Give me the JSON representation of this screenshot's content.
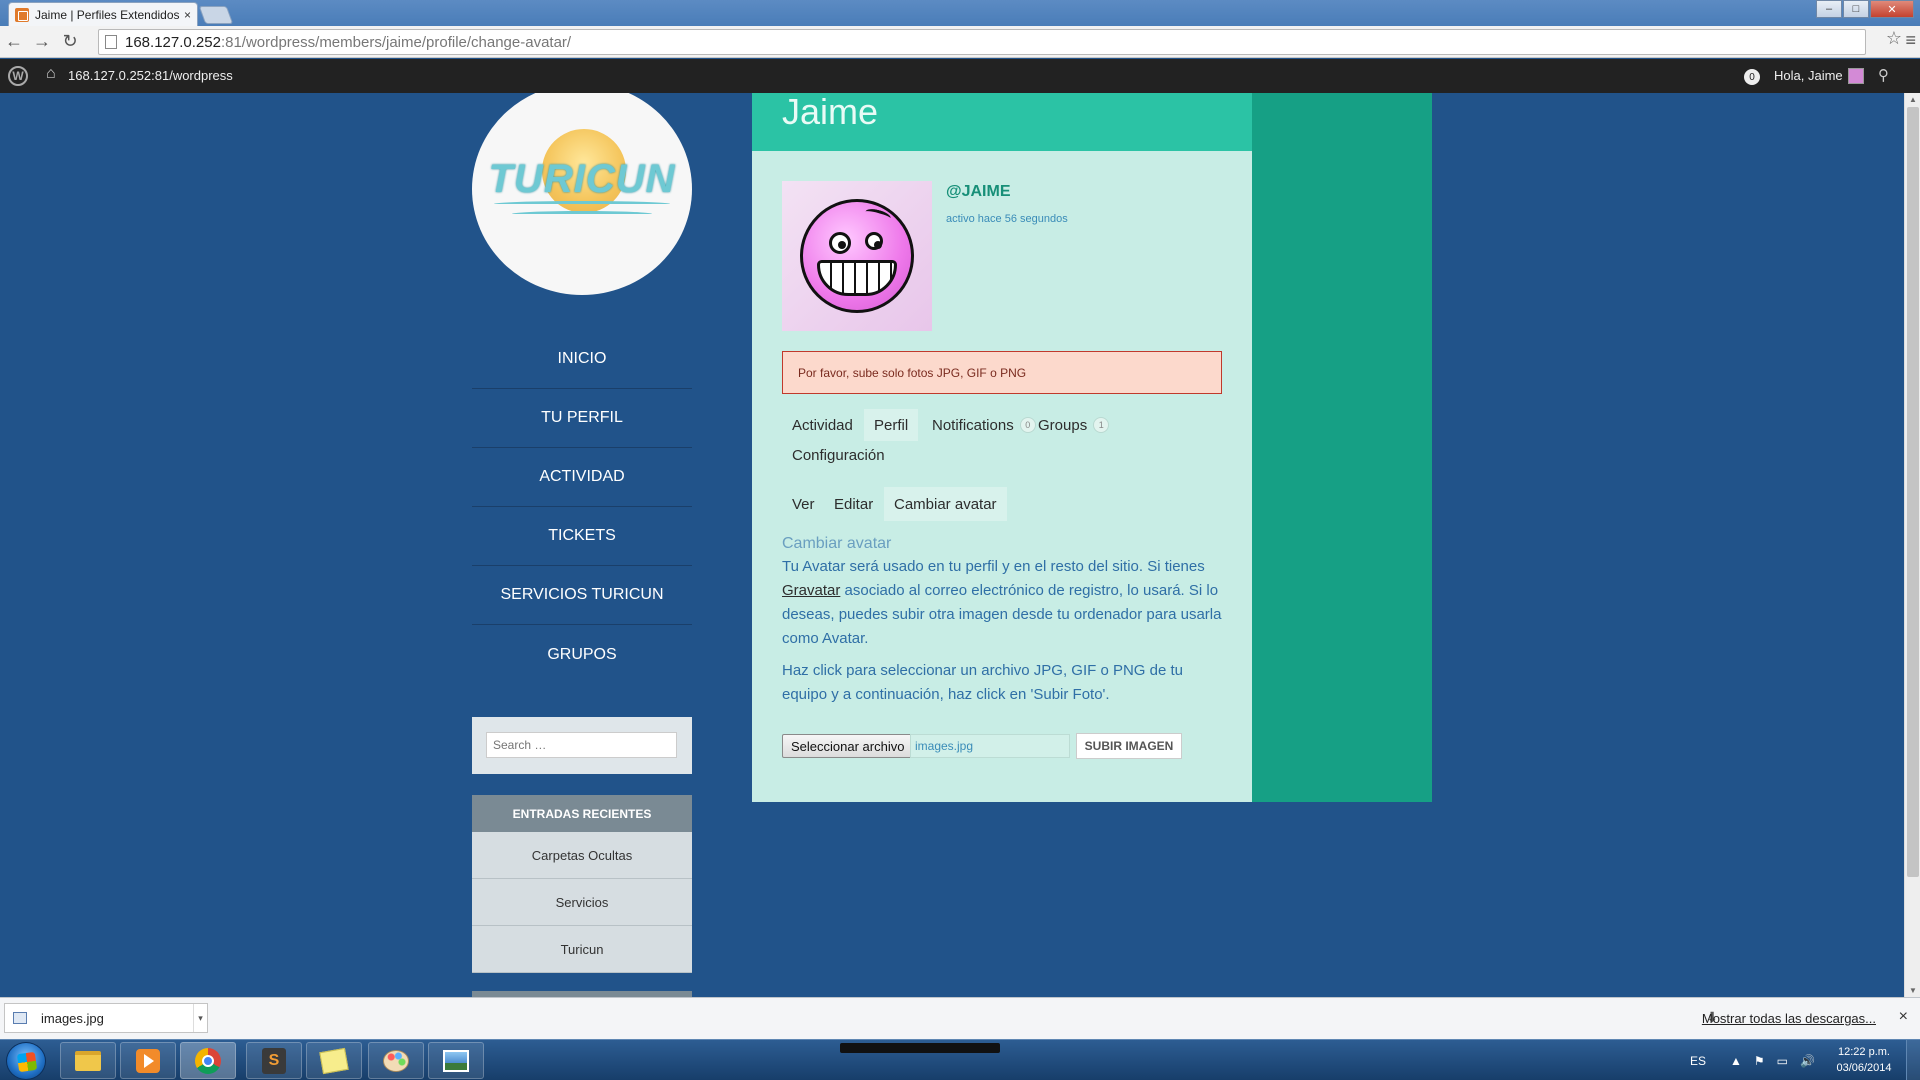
{
  "browser": {
    "tab_title": "Jaime | Perfiles Extendidos",
    "tab_close": "×",
    "window_controls": {
      "minimize": "–",
      "maximize": "□",
      "close": "✕"
    },
    "url_host": "168.127.0.252",
    "url_path": ":81/wordpress/members/jaime/profile/change-avatar/",
    "nav": {
      "back": "←",
      "forward": "→",
      "reload": "↻"
    },
    "star": "☆",
    "menu": "≡"
  },
  "adminbar": {
    "wp_logo": "W",
    "home_icon": "⌂",
    "site_link": "168.127.0.252:81/wordpress",
    "notifications_count": "0",
    "greeting": "Hola, Jaime",
    "search_icon": "⚲"
  },
  "sidebar": {
    "logo_text": "TURICUN",
    "nav_items": [
      "INICIO",
      "TU PERFIL",
      "ACTIVIDAD",
      "TICKETS",
      "SERVICIOS TURICUN",
      "GRUPOS"
    ],
    "search_placeholder": "Search …",
    "recent_heading": "ENTRADAS RECIENTES",
    "recent_items": [
      "Carpetas Ocultas",
      "Servicios",
      "Turicun"
    ]
  },
  "profile": {
    "heading": "Jaime",
    "username": "@JAIME",
    "last_active": "activo hace 56 segundos",
    "error_message": "Por favor, sube solo fotos JPG, GIF o PNG"
  },
  "tabs": {
    "items": [
      {
        "label": "Actividad"
      },
      {
        "label": "Perfil"
      },
      {
        "label": "Notifications",
        "count": "0"
      },
      {
        "label": "Groups",
        "count": "1"
      },
      {
        "label": "Configuración"
      }
    ],
    "current": "Perfil"
  },
  "subtabs": {
    "items": [
      "Ver",
      "Editar",
      "Cambiar avatar"
    ],
    "current": "Cambiar avatar"
  },
  "change_avatar": {
    "title": "Cambiar avatar",
    "para1_before": "Tu Avatar será usado en tu perfil y en el resto del sitio. Si tienes ",
    "para1_link": "Gravatar",
    "para1_after": " asociado al correo electrónico de registro, lo usará. Si lo deseas, puedes subir otra imagen desde tu ordenador para usarla como Avatar.",
    "para2": "Haz click para seleccionar un archivo JPG, GIF o PNG de tu equipo y a continuación, haz click en 'Subir Foto'.",
    "file_button": "Seleccionar archivo",
    "file_name": "images.jpg",
    "upload_button": "SUBIR IMAGEN"
  },
  "downloads": {
    "item_name": "images.jpg",
    "item_arrow": "▾",
    "show_all": "Mostrar todas las descargas...",
    "download_icon": "⬇",
    "close": "×"
  },
  "taskbar": {
    "sublime_letter": "S",
    "language": "ES",
    "tray_up": "▲",
    "tray_flag": "⚑",
    "tray_network": "▭",
    "tray_volume": "🔊",
    "time": "12:22 p.m.",
    "date": "03/06/2014"
  },
  "scrollbar": {
    "up": "▲",
    "down": "▼"
  }
}
